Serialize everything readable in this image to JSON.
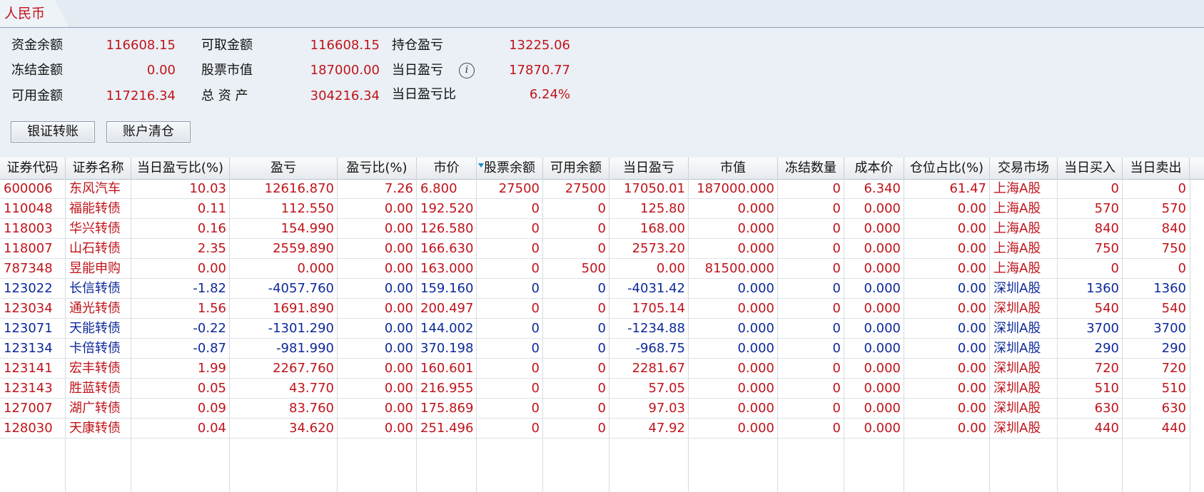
{
  "tab": {
    "label": "人民币"
  },
  "summary": {
    "fund_balance_label": "资金余额",
    "fund_balance": "116608.15",
    "withdrawable_label": "可取金额",
    "withdrawable": "116608.15",
    "position_pl_label": "持仓盈亏",
    "position_pl": "13225.06",
    "frozen_label": "冻结金额",
    "frozen": "0.00",
    "stock_value_label": "股票市值",
    "stock_value": "187000.00",
    "day_pl_label": "当日盈亏",
    "day_pl": "17870.77",
    "available_label": "可用金额",
    "available": "117216.34",
    "total_assets_label": "总 资 产",
    "total_assets": "304216.34",
    "day_pl_ratio_label": "当日盈亏比",
    "day_pl_ratio": "6.24%"
  },
  "buttons": {
    "bank_transfer": "银证转账",
    "clear_positions": "账户清仓"
  },
  "colors": {
    "positive": "#c0141b",
    "negative": "#0d2a9a"
  },
  "table": {
    "headers": [
      "证券代码",
      "证券名称",
      "当日盈亏比(%)",
      "盈亏",
      "盈亏比(%)",
      "市价",
      "股票余额",
      "可用余额",
      "当日盈亏",
      "市值",
      "冻结数量",
      "成本价",
      "仓位占比(%)",
      "交易市场",
      "当日买入",
      "当日卖出"
    ],
    "rows": [
      {
        "color": "red",
        "cells": [
          "600006",
          "东风汽车",
          "10.03",
          "12616.870",
          "7.26",
          "6.800",
          "27500",
          "27500",
          "17050.01",
          "187000.000",
          "0",
          "6.340",
          "61.47",
          "上海A股",
          "0",
          "0"
        ]
      },
      {
        "color": "red",
        "cells": [
          "110048",
          "福能转债",
          "0.11",
          "112.550",
          "0.00",
          "192.520",
          "0",
          "0",
          "125.80",
          "0.000",
          "0",
          "0.000",
          "0.00",
          "上海A股",
          "570",
          "570"
        ]
      },
      {
        "color": "red",
        "cells": [
          "118003",
          "华兴转债",
          "0.16",
          "154.990",
          "0.00",
          "126.580",
          "0",
          "0",
          "168.00",
          "0.000",
          "0",
          "0.000",
          "0.00",
          "上海A股",
          "840",
          "840"
        ]
      },
      {
        "color": "red",
        "cells": [
          "118007",
          "山石转债",
          "2.35",
          "2559.890",
          "0.00",
          "166.630",
          "0",
          "0",
          "2573.20",
          "0.000",
          "0",
          "0.000",
          "0.00",
          "上海A股",
          "750",
          "750"
        ]
      },
      {
        "color": "red",
        "cells": [
          "787348",
          "昱能申购",
          "0.00",
          "0.000",
          "0.00",
          "163.000",
          "0",
          "500",
          "0.00",
          "81500.000",
          "0",
          "0.000",
          "0.00",
          "上海A股",
          "0",
          "0"
        ]
      },
      {
        "color": "blue",
        "cells": [
          "123022",
          "长信转债",
          "-1.82",
          "-4057.760",
          "0.00",
          "159.160",
          "0",
          "0",
          "-4031.42",
          "0.000",
          "0",
          "0.000",
          "0.00",
          "深圳A股",
          "1360",
          "1360"
        ]
      },
      {
        "color": "red",
        "cells": [
          "123034",
          "通光转债",
          "1.56",
          "1691.890",
          "0.00",
          "200.497",
          "0",
          "0",
          "1705.14",
          "0.000",
          "0",
          "0.000",
          "0.00",
          "深圳A股",
          "540",
          "540"
        ]
      },
      {
        "color": "blue",
        "cells": [
          "123071",
          "天能转债",
          "-0.22",
          "-1301.290",
          "0.00",
          "144.002",
          "0",
          "0",
          "-1234.88",
          "0.000",
          "0",
          "0.000",
          "0.00",
          "深圳A股",
          "3700",
          "3700"
        ]
      },
      {
        "color": "blue",
        "cells": [
          "123134",
          "卡倍转债",
          "-0.87",
          "-981.990",
          "0.00",
          "370.198",
          "0",
          "0",
          "-968.75",
          "0.000",
          "0",
          "0.000",
          "0.00",
          "深圳A股",
          "290",
          "290"
        ]
      },
      {
        "color": "red",
        "cells": [
          "123141",
          "宏丰转债",
          "1.99",
          "2267.760",
          "0.00",
          "160.601",
          "0",
          "0",
          "2281.67",
          "0.000",
          "0",
          "0.000",
          "0.00",
          "深圳A股",
          "720",
          "720"
        ]
      },
      {
        "color": "red",
        "cells": [
          "123143",
          "胜蓝转债",
          "0.05",
          "43.770",
          "0.00",
          "216.955",
          "0",
          "0",
          "57.05",
          "0.000",
          "0",
          "0.000",
          "0.00",
          "深圳A股",
          "510",
          "510"
        ]
      },
      {
        "color": "red",
        "cells": [
          "127007",
          "湖广转债",
          "0.09",
          "83.760",
          "0.00",
          "175.869",
          "0",
          "0",
          "97.03",
          "0.000",
          "0",
          "0.000",
          "0.00",
          "深圳A股",
          "630",
          "630"
        ]
      },
      {
        "color": "red",
        "cells": [
          "128030",
          "天康转债",
          "0.04",
          "34.620",
          "0.00",
          "251.496",
          "0",
          "0",
          "47.92",
          "0.000",
          "0",
          "0.000",
          "0.00",
          "深圳A股",
          "440",
          "440"
        ]
      }
    ]
  }
}
